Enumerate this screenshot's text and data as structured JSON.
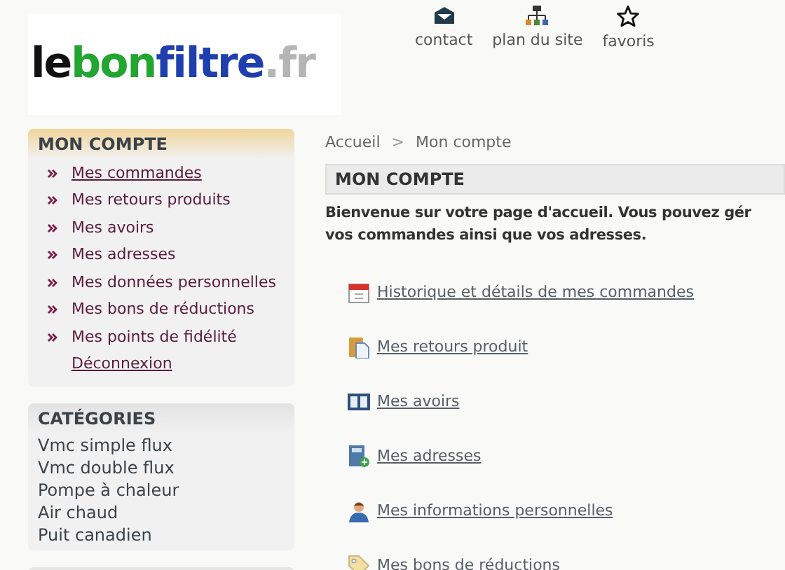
{
  "logo": {
    "parts": [
      {
        "text": "le",
        "color": "#111111"
      },
      {
        "text": "bon",
        "color": "#22a531"
      },
      {
        "text": "filtre",
        "color": "#1f3fae"
      },
      {
        "text": ".fr",
        "color": "#b5b5b5"
      }
    ]
  },
  "top_links": [
    {
      "label": "contact",
      "kind": "mail"
    },
    {
      "label": "plan du site",
      "kind": "sitemap"
    },
    {
      "label": "favoris",
      "kind": "star"
    }
  ],
  "account_panel": {
    "title": "MON COMPTE",
    "items": [
      {
        "label": "Mes commandes",
        "kind": "link",
        "hovered": true
      },
      {
        "label": "Mes retours produits",
        "kind": "link",
        "hovered": false
      },
      {
        "label": "Mes avoirs",
        "kind": "link",
        "hovered": false
      },
      {
        "label": "Mes adresses",
        "kind": "link",
        "hovered": false
      },
      {
        "label": "Mes données personnelles",
        "kind": "link",
        "hovered": false
      },
      {
        "label": "Mes bons de réductions",
        "kind": "link",
        "hovered": false
      },
      {
        "label": "Mes points de fidélité",
        "kind": "link",
        "hovered": false
      },
      {
        "label": "Déconnexion",
        "kind": "logout",
        "hovered": false
      }
    ]
  },
  "categories_panel": {
    "title": "CATÉGORIES",
    "items": [
      "Vmc simple flux",
      "Vmc double flux",
      "Pompe à chaleur",
      "Air chaud",
      "Puit canadien"
    ]
  },
  "breadcrumb": {
    "items": [
      "Accueil",
      "Mon compte"
    ],
    "separator": ">"
  },
  "page_title": "MON COMPTE",
  "welcome": [
    "Bienvenue sur votre page d'accueil. Vous pouvez gér",
    "vos commandes ainsi que vos adresses."
  ],
  "account_links": [
    {
      "label": "Historique et détails de mes commandes",
      "kind": "calendar"
    },
    {
      "label": "Mes retours produit",
      "kind": "clipboard"
    },
    {
      "label": "Mes avoirs",
      "kind": "book"
    },
    {
      "label": "Mes adresses",
      "kind": "addressbook"
    },
    {
      "label": "Mes informations personnelles",
      "kind": "person"
    },
    {
      "label": "Mes bons de réductions",
      "kind": "tag"
    }
  ]
}
